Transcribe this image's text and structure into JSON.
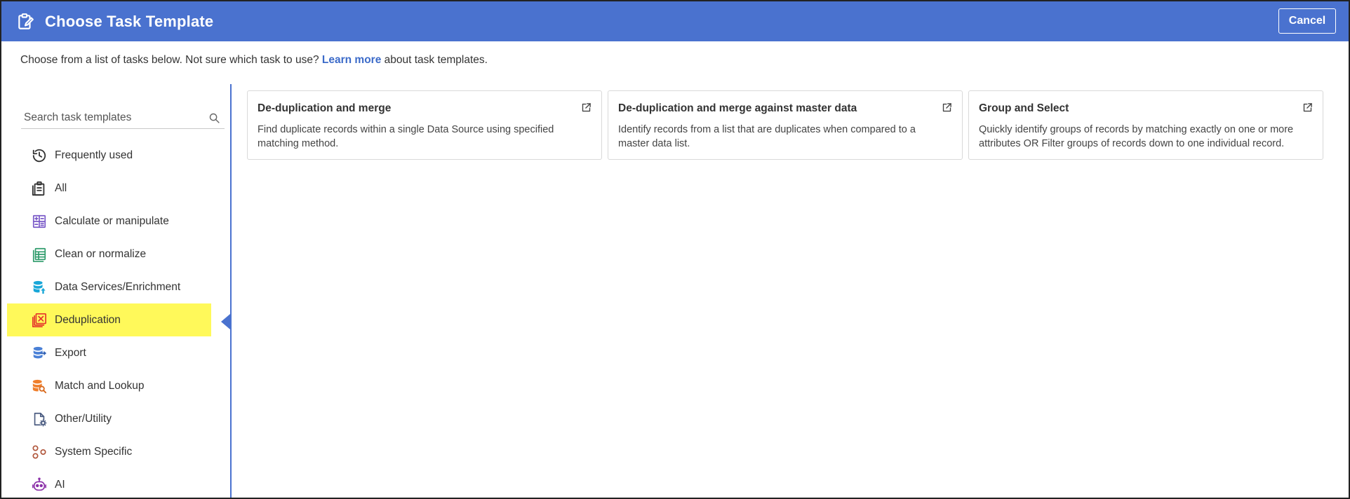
{
  "header": {
    "title": "Choose Task Template",
    "cancel_label": "Cancel",
    "bg_color": "#4a72cf"
  },
  "intro": {
    "prefix": "Choose from a list of tasks below. Not sure which task to use?",
    "link_label": "Learn more",
    "suffix": "about task templates."
  },
  "search": {
    "placeholder": "Search task templates"
  },
  "sidebar": {
    "items": [
      {
        "label": "Frequently used",
        "icon": "history-icon"
      },
      {
        "label": "All",
        "icon": "clipboard-list-icon"
      },
      {
        "label": "Calculate or manipulate",
        "icon": "calculator-icon"
      },
      {
        "label": "Clean or normalize",
        "icon": "spreadsheet-icon"
      },
      {
        "label": "Data Services/Enrichment",
        "icon": "database-upload-icon"
      },
      {
        "label": "Deduplication",
        "icon": "dedupe-icon",
        "active": true
      },
      {
        "label": "Export",
        "icon": "database-export-icon"
      },
      {
        "label": "Match and Lookup",
        "icon": "database-search-icon"
      },
      {
        "label": "Other/Utility",
        "icon": "file-gear-icon"
      },
      {
        "label": "System Specific",
        "icon": "nodes-icon"
      },
      {
        "label": "AI",
        "icon": "robot-icon"
      }
    ]
  },
  "cards": [
    {
      "title": "De-duplication and merge",
      "description": "Find duplicate records within a single Data Source using specified matching method."
    },
    {
      "title": "De-duplication and merge against master data",
      "description": "Identify records from a list that are duplicates when compared to a master data list."
    },
    {
      "title": "Group and Select",
      "description": "Quickly identify groups of records by matching exactly on one or more attributes OR Filter groups of records down to one individual record."
    }
  ]
}
